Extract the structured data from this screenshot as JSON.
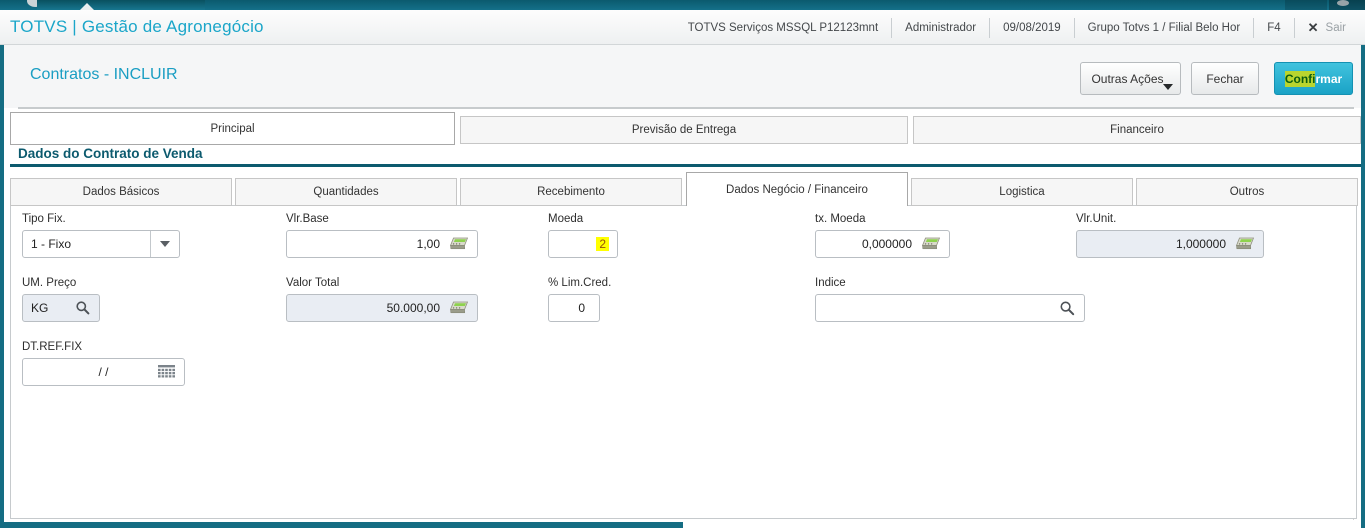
{
  "header": {
    "app_title": "TOTVS | Gestão de Agronegócio",
    "server": "TOTVS Serviços MSSQL P12123mnt",
    "user": "Administrador",
    "date": "09/08/2019",
    "company": "Grupo Totvs 1 / Filial Belo Hor",
    "shortcut": "F4",
    "close_icon": "✕",
    "exit_label": "Sair"
  },
  "toolbar": {
    "page_title": "Contratos - INCLUIR",
    "other_actions_label": "Outras Ações",
    "close_label": "Fechar",
    "confirm_highlight": "Confi",
    "confirm_rest": "rmar"
  },
  "main_tabs": [
    {
      "label": "Principal",
      "active": true
    },
    {
      "label": "Previsão de Entrega",
      "active": false
    },
    {
      "label": "Financeiro",
      "active": false
    }
  ],
  "section": {
    "title": "Dados do Contrato de Venda"
  },
  "sub_tabs": [
    {
      "label": "Dados Básicos",
      "active": false
    },
    {
      "label": "Quantidades",
      "active": false
    },
    {
      "label": "Recebimento",
      "active": false
    },
    {
      "label": "Dados Negócio / Financeiro",
      "active": true
    },
    {
      "label": "Logistica",
      "active": false
    },
    {
      "label": "Outros",
      "active": false
    }
  ],
  "form": {
    "tipo_fix": {
      "label": "Tipo Fix.",
      "value": "1 - Fixo"
    },
    "vlr_base": {
      "label": "Vlr.Base",
      "value": "1,00"
    },
    "moeda": {
      "label": "Moeda",
      "value": "2",
      "highlighted": true
    },
    "tx_moeda": {
      "label": "tx. Moeda",
      "value": "0,000000"
    },
    "vlr_unit": {
      "label": "Vlr.Unit.",
      "value": "1,000000"
    },
    "um_preco": {
      "label": "UM. Preço",
      "value": "KG"
    },
    "valor_total": {
      "label": "Valor Total",
      "value": "50.000,00"
    },
    "lim_cred": {
      "label": "% Lim.Cred.",
      "value": "0"
    },
    "indice": {
      "label": "Indice",
      "value": ""
    },
    "dt_ref_fix": {
      "label": "DT.REF.FIX",
      "value": "/ /"
    }
  },
  "icons": {
    "dropdown": "triangle-down",
    "calculator": "calculator-glyph",
    "search": "magnifier-glyph",
    "calendar": "grid-glyph",
    "close": "✕"
  },
  "colors": {
    "brand_teal": "#1ba6c9",
    "dark_teal": "#0c5a6e",
    "edge_teal": "#156d83",
    "confirm_button": "#1aa2c6",
    "find_highlight_green": "#b9d52f",
    "find_highlight_yellow": "#ffff00",
    "disabled_field_bg": "#e9edf3"
  }
}
